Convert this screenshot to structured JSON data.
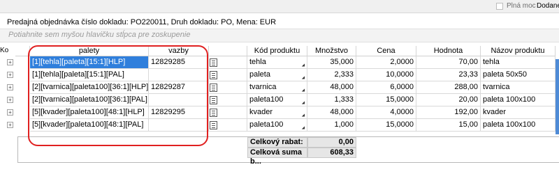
{
  "topbar": {
    "checkbox_label": "Plná moc",
    "cut_label": "Dodane"
  },
  "info_line": "Predajná objednávka číslo dokladu: PO220011, Druh dokladu: PO, Mena: EUR",
  "group_hint": "Potiahnite sem myšou hlavičku stĺpca pre zoskupenie",
  "left_stub": "Ko",
  "columns": {
    "palety": "palety",
    "vazby": "vazby",
    "kod": "Kód produktu",
    "mnozstvo": "Množstvo",
    "cena": "Cena",
    "hodnota": "Hodnota",
    "nazov": "Názov produktu"
  },
  "rows": [
    {
      "palety": "[1][tehla][paleta][15:1][HLP]",
      "vazby": "12829285",
      "kod": "tehla",
      "mnozstvo": "35,000",
      "cena": "2,0000",
      "hodnota": "70,00",
      "nazov": "tehla"
    },
    {
      "palety": "[1][tehla][paleta][15:1][PAL]",
      "vazby": "",
      "kod": "paleta",
      "mnozstvo": "2,333",
      "cena": "10,0000",
      "hodnota": "23,33",
      "nazov": "paleta 50x50"
    },
    {
      "palety": "[2][tvarnica][paleta100][36:1][HLP]",
      "vazby": "12829287",
      "kod": "tvarnica",
      "mnozstvo": "48,000",
      "cena": "6,0000",
      "hodnota": "288,00",
      "nazov": "tvarnica"
    },
    {
      "palety": "[2][tvarnica][paleta100][36:1][PAL]",
      "vazby": "",
      "kod": "paleta100",
      "mnozstvo": "1,333",
      "cena": "15,0000",
      "hodnota": "20,00",
      "nazov": "paleta 100x100"
    },
    {
      "palety": "[5][kvader][paleta100][48:1][HLP]",
      "vazby": "12829295",
      "kod": "kvader",
      "mnozstvo": "48,000",
      "cena": "4,0000",
      "hodnota": "192,00",
      "nazov": "kvader"
    },
    {
      "palety": "[5][kvader][paleta100][48:1][PAL]",
      "vazby": "",
      "kod": "paleta100",
      "mnozstvo": "1,000",
      "cena": "15,0000",
      "hodnota": "15,00",
      "nazov": "paleta 100x100"
    }
  ],
  "summary": {
    "rabat_label": "Celkový rabat:",
    "rabat_value": "0,00",
    "suma_label": "Celková suma b...",
    "suma_value": "608,33"
  },
  "colors": {
    "selection": "#2f7fdc",
    "annotation": "#e02020"
  }
}
